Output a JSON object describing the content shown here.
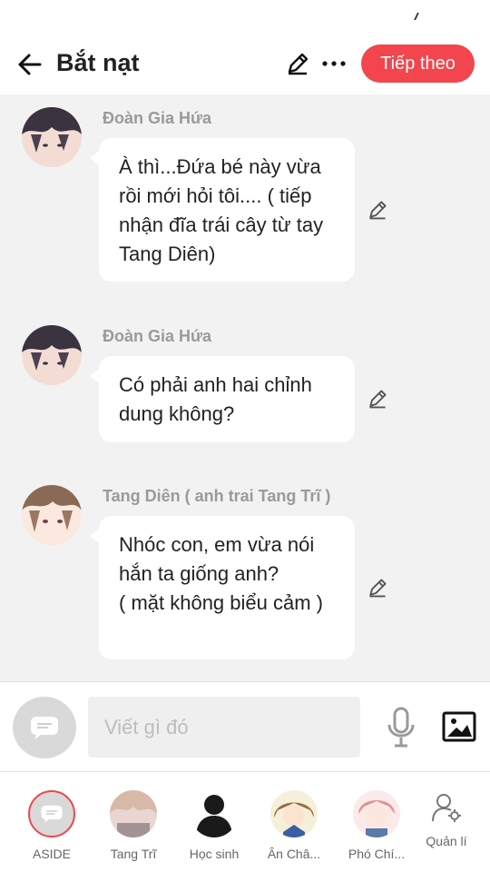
{
  "header": {
    "title": "Bắt nạt",
    "next_label": "Tiếp theo"
  },
  "messages": [
    {
      "sender": "Đoàn Gia Hứa",
      "text": "À thì...Đứa bé này vừa rồi mới hỏi tôi.... ( tiếp nhận đĩa trái cây từ tay Tang Diên)"
    },
    {
      "sender": "Đoàn Gia Hứa",
      "text": "Có phải anh hai chỉnh dung không?"
    },
    {
      "sender": "Tang Diên ( anh trai Tang Trĩ )",
      "text": "Nhóc con, em vừa nói hắn ta giống anh?\n( mặt không biểu cảm )"
    }
  ],
  "composer": {
    "placeholder": "Viết gì đó"
  },
  "characters": [
    {
      "name": "ASIDE"
    },
    {
      "name": "Tang Trĩ"
    },
    {
      "name": "Học sinh"
    },
    {
      "name": "Ân Châ..."
    },
    {
      "name": "Phó Chí..."
    }
  ],
  "manage_label": "Quản lí",
  "colors": {
    "accent": "#f2454d",
    "background": "#f2f2f2",
    "bubble": "#ffffff"
  }
}
